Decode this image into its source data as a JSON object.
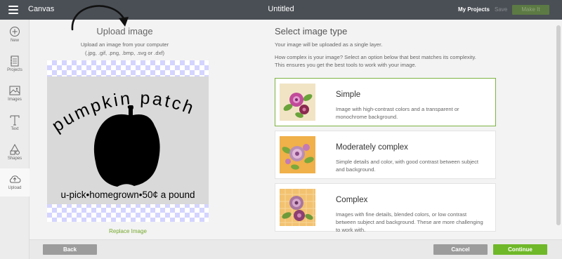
{
  "header": {
    "app_name": "Canvas",
    "doc_title": "Untitled",
    "my_projects": "My Projects",
    "save": "Save",
    "make_it": "Make It"
  },
  "sidebar": {
    "items": [
      {
        "label": "New",
        "icon": "plus-circle-icon"
      },
      {
        "label": "Projects",
        "icon": "projects-icon"
      },
      {
        "label": "Images",
        "icon": "image-icon"
      },
      {
        "label": "Text",
        "icon": "text-icon"
      },
      {
        "label": "Shapes",
        "icon": "shapes-icon"
      },
      {
        "label": "Upload",
        "icon": "upload-cloud-icon",
        "active": true
      }
    ]
  },
  "upload": {
    "title": "Upload image",
    "desc_line1": "Upload an image from your computer",
    "desc_line2": "(.jpg, .gif, .png, .bmp, .svg or .dxf)",
    "image_text_top": "pumpkin patch",
    "image_text_bottom": "u-pick•homegrown•50¢ a pound",
    "replace": "Replace Image"
  },
  "select": {
    "title": "Select image type",
    "desc1": "Your image will be uploaded as a single layer.",
    "desc2_line1": "How complex is your image? Select an option below that best matches its complexity.",
    "desc2_line2": "This ensures you get the best tools to work with your image.",
    "options": [
      {
        "title": "Simple",
        "desc": "Image with high-contrast colors and a transparent or monochrome background.",
        "selected": true
      },
      {
        "title": "Moderately complex",
        "desc": "Simple details and color, with good contrast between subject and background.",
        "selected": false
      },
      {
        "title": "Complex",
        "desc": "Images with fine details, blended colors, or low contrast between subject and background. These are more challenging to work with.",
        "selected": false
      }
    ]
  },
  "footer": {
    "back": "Back",
    "cancel": "Cancel",
    "continue": "Continue"
  },
  "colors": {
    "topbar": "#4a4f55",
    "accent_green": "#6fb829",
    "selected_border": "#7cb342",
    "checker": "#d4d4ff"
  }
}
